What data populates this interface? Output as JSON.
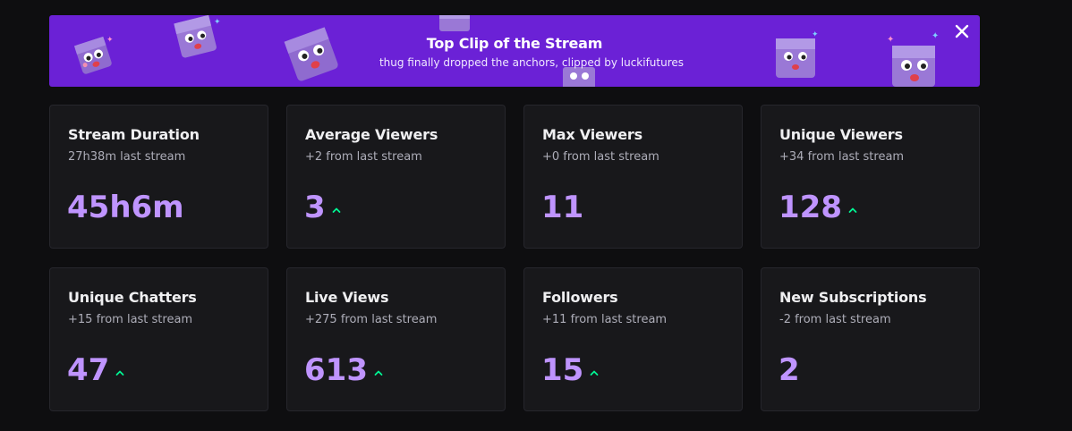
{
  "banner": {
    "title": "Top Clip of the Stream",
    "subtitle": "thug finally dropped the anchors, clipped by luckifutures",
    "background": "#6b21d6"
  },
  "stats": [
    {
      "title": "Stream Duration",
      "sub": "27h38m last stream",
      "value": "45h6m",
      "trend": "none"
    },
    {
      "title": "Average Viewers",
      "sub": "+2 from last stream",
      "value": "3",
      "trend": "up"
    },
    {
      "title": "Max Viewers",
      "sub": "+0 from last stream",
      "value": "11",
      "trend": "none"
    },
    {
      "title": "Unique Viewers",
      "sub": "+34 from last stream",
      "value": "128",
      "trend": "up"
    },
    {
      "title": "Unique Chatters",
      "sub": "+15 from last stream",
      "value": "47",
      "trend": "up"
    },
    {
      "title": "Live Views",
      "sub": "+275 from last stream",
      "value": "613",
      "trend": "up"
    },
    {
      "title": "Followers",
      "sub": "+11 from last stream",
      "value": "15",
      "trend": "up"
    },
    {
      "title": "New Subscriptions",
      "sub": "-2 from last stream",
      "value": "2",
      "trend": "none"
    }
  ],
  "colors": {
    "accent": "#bf94ff",
    "trend_up": "#00f593",
    "card_bg": "#18181b",
    "page_bg": "#0e0e10"
  },
  "icons": {
    "close": "close-icon",
    "trend": "arrow-up-icon",
    "mascot": "mascot-icon"
  }
}
